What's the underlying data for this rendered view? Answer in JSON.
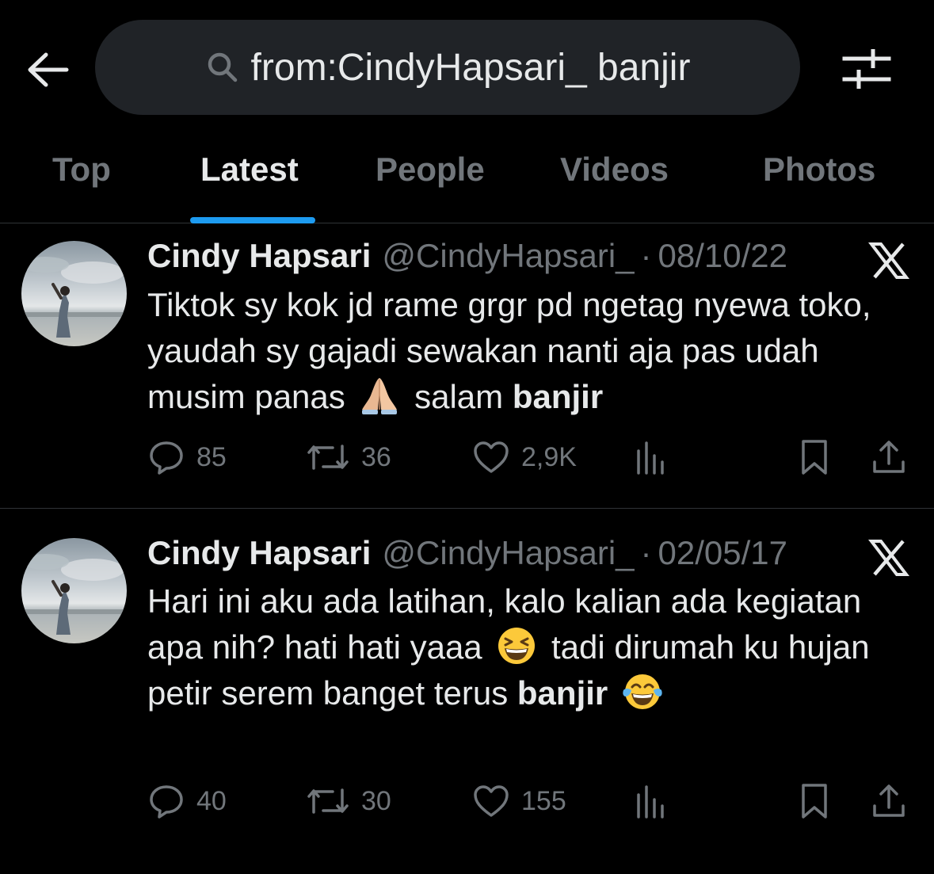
{
  "header": {
    "search_query": "from:CindyHapsari_ banjir",
    "back_icon": "arrow-left-icon",
    "filter_icon": "sliders-icon"
  },
  "tabs": [
    {
      "label": "Top",
      "active": false
    },
    {
      "label": "Latest",
      "active": true
    },
    {
      "label": "People",
      "active": false
    },
    {
      "label": "Videos",
      "active": false
    },
    {
      "label": "Photos",
      "active": false
    }
  ],
  "colors": {
    "background": "#000000",
    "accent": "#1d9bf0",
    "text_primary": "#e7e9ea",
    "text_secondary": "#71767b",
    "search_bg": "#202327",
    "divider": "#2f3336"
  },
  "tweets": [
    {
      "author_name": "Cindy Hapsari",
      "author_handle": "@CindyHapsari_",
      "separator": "·",
      "date": "08/10/22",
      "text_1": "Tiktok sy kok jd rame grgr pd ngetag  nyewa toko, yaudah sy gajadi sewakan nanti aja pas udah musim panas ",
      "emoji_1": "folded-hands-emoji",
      "text_2": " salam ",
      "bold": "banjir",
      "replies": "85",
      "reposts": "36",
      "likes": "2,9K"
    },
    {
      "author_name": "Cindy Hapsari",
      "author_handle": "@CindyHapsari_",
      "separator": "·",
      "date": "02/05/17",
      "text_1": "Hari ini aku ada latihan, kalo kalian ada kegiatan apa nih? hati hati yaaa ",
      "emoji_1": "grinning-squinting-face-emoji",
      "text_2": " tadi dirumah ku hujan petir serem banget terus ",
      "bold": "banjir",
      "emoji_2": "face-with-tears-of-joy-emoji",
      "replies": "40",
      "reposts": "30",
      "likes": "155"
    }
  ]
}
